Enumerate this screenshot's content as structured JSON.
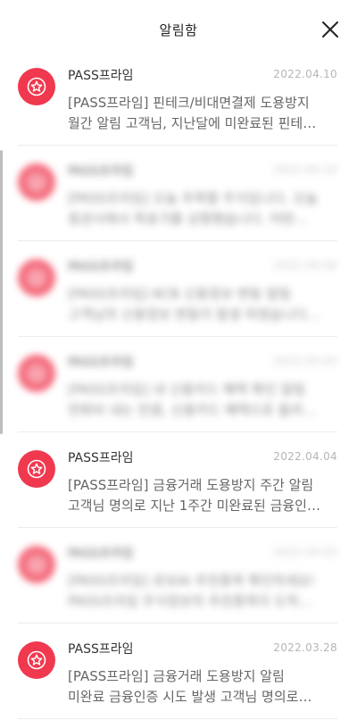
{
  "header": {
    "title": "알림함",
    "close_icon": "close-icon"
  },
  "accent_color": "#f0384f",
  "notifications": [
    {
      "sender": "PASS프라임",
      "date": "2022.04.10",
      "line1": "[PASS프라임] 핀테크/비대면결제 도용방지",
      "line2": "월간 알림 고객님, 지난달에 미완료된 핀테…",
      "blurred": false
    },
    {
      "sender": "PASS프라임",
      "date": "2022.04.10",
      "line1": "[PASS프라임] 오늘 추목할 주식입니다. 오늘",
      "line2": "증권사에서 목표가를 상향했습니다. 어떤…",
      "blurred": true
    },
    {
      "sender": "PASS프라임",
      "date": "2022.04.06",
      "line1": "[PASS프라임] KCB 신용정보 변동 알림",
      "line2": "고객님의 신용정보 변동이 발생 하였습니다…",
      "blurred": true
    },
    {
      "sender": "PASS프라임",
      "date": "2022.04.05",
      "line1": "[PASS프라임] 내 신용카드 혜택 확인 알림",
      "line2": "연회비 내는 만큼, 신용카드 혜택으로 돌려…",
      "blurred": true
    },
    {
      "sender": "PASS프라임",
      "date": "2022.04.04",
      "line1": "[PASS프라임] 금융거래 도용방지 주간 알림",
      "line2": "고객님 명의로 지난 1주간 미완료된 금융인…",
      "blurred": false
    },
    {
      "sender": "PASS프라임",
      "date": "2022.04.02",
      "line1": "[PASS프라임] 로보AI 추천종목 확인하세요!",
      "line2": "PASS프라임 주식정보의 추천종목이 도착…",
      "blurred": true
    },
    {
      "sender": "PASS프라임",
      "date": "2022.03.28",
      "line1": "[PASS프라임] 금융거래 도용방지 알림",
      "line2": "미완료 금융인증 시도 발생 고객님 명의로…",
      "blurred": false
    }
  ]
}
